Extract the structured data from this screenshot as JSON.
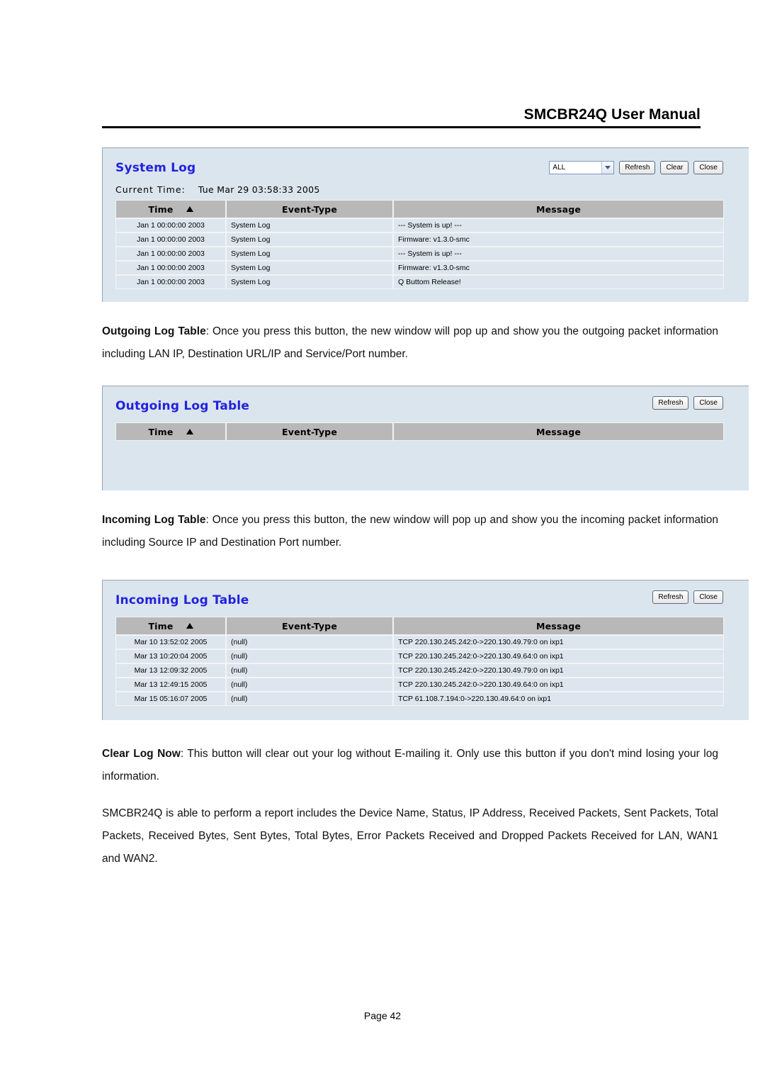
{
  "header": {
    "manual_title": "SMCBR24Q User Manual"
  },
  "footer": {
    "page_label": "Page 42"
  },
  "system_log_panel": {
    "title": "System Log",
    "current_time_label": "Current Time:",
    "current_time_value": "Tue Mar 29 03:58:33 2005",
    "filter_selected": "ALL",
    "filter_icon": "chevron-down-icon",
    "buttons": {
      "refresh": "Refresh",
      "clear": "Clear",
      "close": "Close"
    },
    "columns": {
      "time": "Time",
      "event_type": "Event-Type",
      "message": "Message",
      "sort_icon": "sort-ascending-icon"
    },
    "rows": [
      {
        "time": "Jan 1 00:00:00 2003",
        "event_type": "System Log",
        "message": "--- System is up! ---"
      },
      {
        "time": "Jan 1 00:00:00 2003",
        "event_type": "System Log",
        "message": "Firmware: v1.3.0-smc"
      },
      {
        "time": "Jan 1 00:00:00 2003",
        "event_type": "System Log",
        "message": "--- System is up! ---"
      },
      {
        "time": "Jan 1 00:00:00 2003",
        "event_type": "System Log",
        "message": "Firmware: v1.3.0-smc"
      },
      {
        "time": "Jan 1 00:00:00 2003",
        "event_type": "System Log",
        "message": "Q Buttom Release!"
      }
    ]
  },
  "outgoing_log_panel": {
    "title": "Outgoing Log Table",
    "buttons": {
      "refresh": "Refresh",
      "close": "Close"
    },
    "columns": {
      "time": "Time",
      "event_type": "Event-Type",
      "message": "Message",
      "sort_icon": "sort-ascending-icon"
    },
    "rows": []
  },
  "incoming_log_panel": {
    "title": "Incoming Log Table",
    "buttons": {
      "refresh": "Refresh",
      "close": "Close"
    },
    "columns": {
      "time": "Time",
      "event_type": "Event-Type",
      "message": "Message",
      "sort_icon": "sort-ascending-icon"
    },
    "rows": [
      {
        "time": "Mar 10 13:52:02 2005",
        "event_type": "(null)",
        "message": "TCP 220.130.245.242:0->220.130.49.79:0 on ixp1"
      },
      {
        "time": "Mar 13 10:20:04 2005",
        "event_type": "(null)",
        "message": "TCP 220.130.245.242:0->220.130.49.64:0 on ixp1"
      },
      {
        "time": "Mar 13 12:09:32 2005",
        "event_type": "(null)",
        "message": "TCP 220.130.245.242:0->220.130.49.79:0 on ixp1"
      },
      {
        "time": "Mar 13 12:49:15 2005",
        "event_type": "(null)",
        "message": "TCP 220.130.245.242:0->220.130.49.64:0 on ixp1"
      },
      {
        "time": "Mar 15 05:16:07 2005",
        "event_type": "(null)",
        "message": "TCP 61.108.7.194:0->220.130.49.64:0 on ixp1"
      }
    ]
  },
  "paragraphs": {
    "outgoing": {
      "term": "Outgoing Log Table",
      "text": ": Once you press this button, the new window will pop up and show you the outgoing packet information including LAN IP, Destination URL/IP and Service/Port number."
    },
    "incoming": {
      "term": "Incoming Log Table",
      "text": ": Once you press this button, the new window will pop up and show you the incoming packet information including Source IP and Destination Port number."
    },
    "clear_log": {
      "term": "Clear Log Now",
      "text": ": This button will clear out your log without E-mailing it. Only use this button if you don't mind losing your log information."
    },
    "report": {
      "text": "SMCBR24Q is able to perform a report includes the Device Name, Status, IP Address, Received Packets, Sent Packets, Total Packets, Received Bytes, Sent Bytes, Total Bytes, Error Packets Received and Dropped Packets Received for LAN, WAN1 and WAN2."
    }
  },
  "colors": {
    "panel_background": "#dbe5ed",
    "panel_title": "#2222dd",
    "table_header": "#b8b8b8",
    "row_background": "#dde6ee",
    "null_text": "#3a3ab8"
  }
}
